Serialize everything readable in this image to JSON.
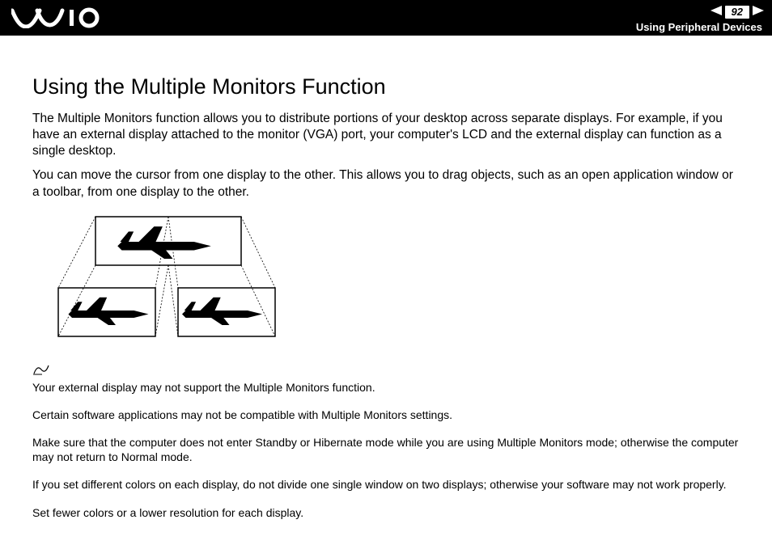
{
  "header": {
    "page_number": "92",
    "section": "Using Peripheral Devices"
  },
  "title": "Using the Multiple Monitors Function",
  "paragraphs": [
    "The Multiple Monitors function allows you to distribute portions of your desktop across separate displays. For example, if you have an external display attached to the monitor (VGA) port, your computer's LCD and the external display can function as a single desktop.",
    "You can move the cursor from one display to the other. This allows you to drag objects, such as an open application window or a toolbar, from one display to the other."
  ],
  "notes": [
    "Your external display may not support the Multiple Monitors function.",
    "Certain software applications may not be compatible with Multiple Monitors settings.",
    "Make sure that the computer does not enter Standby or Hibernate mode while you are using Multiple Monitors mode; otherwise the computer may not return to Normal mode.",
    "If you set different colors on each display, do not divide one single window on two displays; otherwise your software may not work properly.",
    "Set fewer colors or a lower resolution for each display."
  ]
}
